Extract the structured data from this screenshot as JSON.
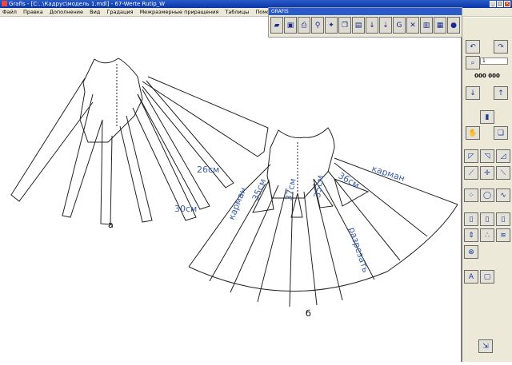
{
  "window": {
    "title": "Grafis - [C:..\\Кадрус\\модель 1.mdl] - 67-Werte Rutip_W"
  },
  "menu": [
    "Файл",
    "Правка",
    "Дополнение",
    "Вид",
    "Градация",
    "Межразмерные приращения",
    "Таблицы",
    "Помощь"
  ],
  "toolbar": {
    "title": "GRAFIS"
  },
  "right_panel": {
    "counter": "000 000",
    "field_value": "1"
  },
  "drawing": {
    "label_a": "а",
    "label_b": "б",
    "a_26": "26см",
    "a_30": "30см",
    "b_karman_left": "карман",
    "b_35_left": "35см",
    "b_37": "37см",
    "b_35_right": "35см",
    "b_36": "36см",
    "b_karman_right": "карман",
    "b_razrezat": "разрезать"
  }
}
